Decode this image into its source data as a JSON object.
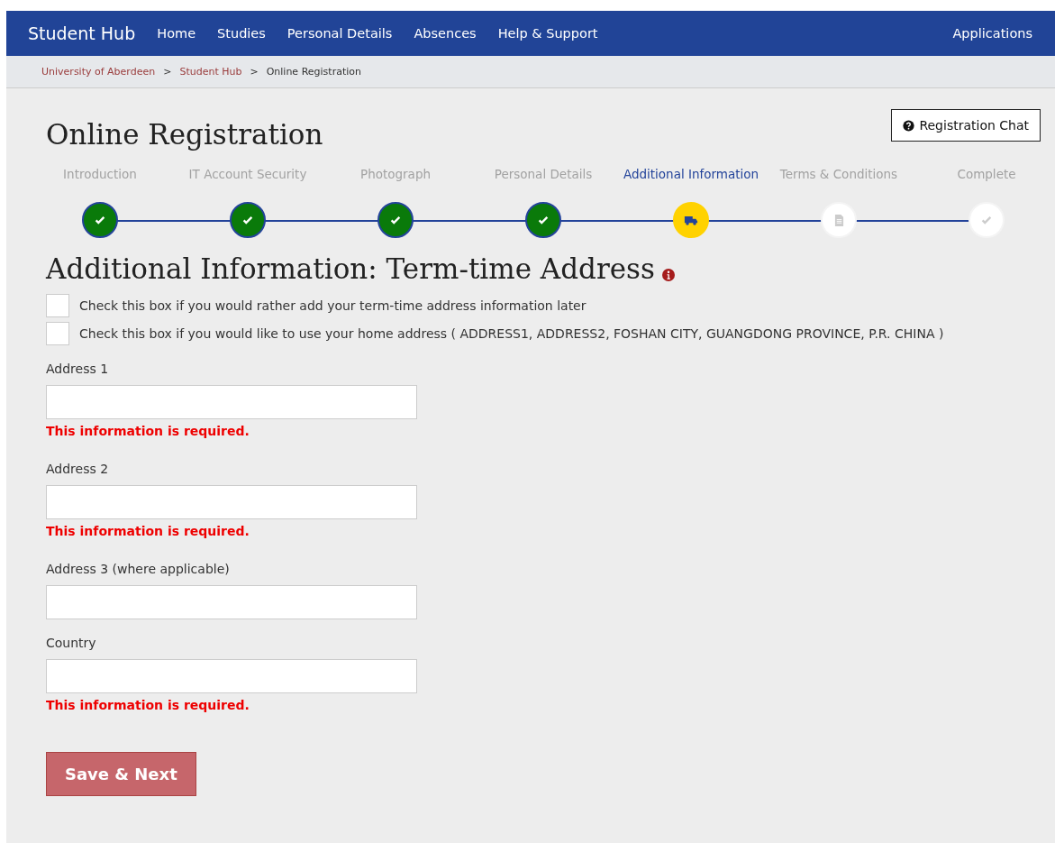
{
  "nav": {
    "brand": "Student Hub",
    "items": [
      {
        "label": "Home"
      },
      {
        "label": "Studies"
      },
      {
        "label": "Personal Details"
      },
      {
        "label": "Absences"
      },
      {
        "label": "Help & Support"
      }
    ],
    "right": "Applications"
  },
  "breadcrumb": [
    {
      "label": "University of Aberdeen",
      "link": true
    },
    {
      "label": "Student Hub",
      "link": true
    },
    {
      "label": "Online Registration",
      "link": false
    }
  ],
  "breadcrumb_separator": ">",
  "page_title": "Online Registration",
  "chat_button": "Registration Chat",
  "steps": [
    {
      "label": "Introduction",
      "kind": "done"
    },
    {
      "label": "IT Account Security",
      "kind": "done"
    },
    {
      "label": "Photograph",
      "kind": "done"
    },
    {
      "label": "Personal Details",
      "kind": "done"
    },
    {
      "label": "Additional Information",
      "kind": "current"
    },
    {
      "label": "Terms & Conditions",
      "kind": "pending"
    },
    {
      "label": "Complete",
      "kind": "final"
    }
  ],
  "section_title": "Additional Information: Term-time Address",
  "checkboxes": [
    {
      "label": "Check this box if you would rather add your term-time address information later",
      "checked": false
    },
    {
      "label": "Check this box if you would like to use your home address ( ADDRESS1, ADDRESS2, FOSHAN CITY, GUANGDONG PROVINCE, P.R. CHINA )",
      "checked": false
    }
  ],
  "fields": [
    {
      "label": "Address 1",
      "error": "This information is required."
    },
    {
      "label": "Address 2",
      "error": "This information is required."
    },
    {
      "label": "Address 3 (where applicable)"
    },
    {
      "label": "Country",
      "error": "This information is required."
    }
  ],
  "submit": "Save & Next"
}
